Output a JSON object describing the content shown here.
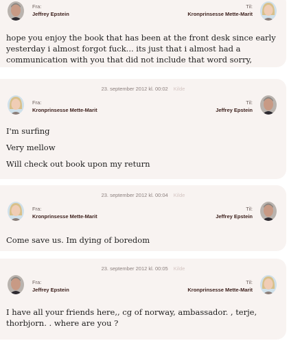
{
  "labels": {
    "from": "Fra:",
    "to": "Til:",
    "source": "Kilde"
  },
  "messages": [
    {
      "timestamp": "",
      "from": "Jeffrey Epstein",
      "to": "Kronprinsesse Mette-Marit",
      "lines": [
        "hope you enjoy the book that has been at the front desk since early yesterday i almost forgot fuck... its just that i almost had a communication with you that did not include that word sorry,"
      ]
    },
    {
      "timestamp": "23. september 2012 kl. 00:02",
      "from": "Kronprinsesse Mette-Marit",
      "to": "Jeffrey Epstein",
      "lines": [
        "I'm surfing",
        "Very mellow",
        "Will check out book upon my return"
      ]
    },
    {
      "timestamp": "23. september 2012 kl. 00:04",
      "from": "Kronprinsesse Mette-Marit",
      "to": "Jeffrey Epstein",
      "lines": [
        "Come save us. Im dying of boredom"
      ]
    },
    {
      "timestamp": "23. september 2012 kl. 00:05",
      "from": "Jeffrey Epstein",
      "to": "Kronprinsesse Mette-Marit",
      "lines": [
        "I have all your friends here,, cg of norway, ambassador. , terje, thorbjorn. . where are you ?"
      ]
    }
  ],
  "colors": {
    "card_bg": "#f8f3f1",
    "name": "#3b1e1a",
    "meta": "#8b7f7d",
    "source_link": "#d4c5c2"
  }
}
